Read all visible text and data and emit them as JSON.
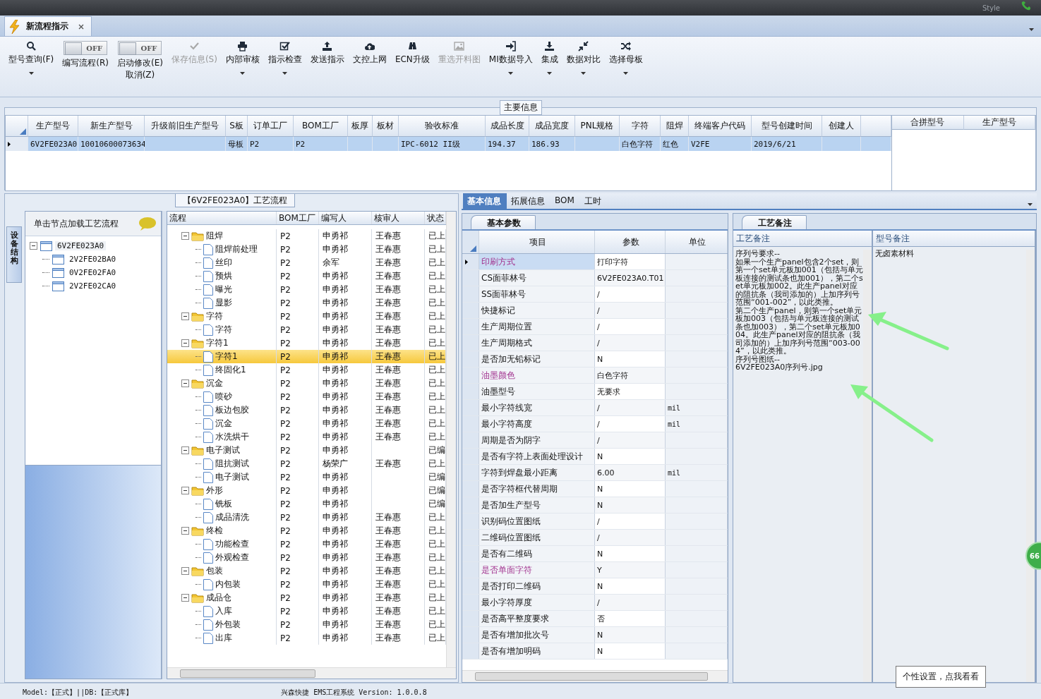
{
  "top_bar": {
    "style_label": "Style"
  },
  "document_tabs": [
    {
      "label": "新流程指示",
      "selected": true,
      "closable": true
    }
  ],
  "toolbar": [
    {
      "kind": "button",
      "label": "型号查询(F)",
      "disabled": false,
      "menu": true
    },
    {
      "kind": "toggle",
      "switch_text": "OFF",
      "on": false,
      "label": "编写流程(R)",
      "menu": false
    },
    {
      "kind": "toggle",
      "switch_text": "OFF",
      "on": false,
      "label": "启动修改(E)",
      "label_2": "取消(Z)",
      "menu": false
    },
    {
      "kind": "button",
      "label": "保存信息(S)",
      "disabled": true,
      "menu": false
    },
    {
      "kind": "button",
      "label": "内部审核",
      "disabled": false,
      "menu": true
    },
    {
      "kind": "button",
      "label": "指示检查",
      "disabled": false,
      "menu": true
    },
    {
      "kind": "button",
      "label": "发送指示",
      "disabled": false,
      "menu": false
    },
    {
      "kind": "button",
      "label": "文控上网",
      "disabled": false,
      "menu": false
    },
    {
      "kind": "button",
      "label": "ECN升级",
      "disabled": false,
      "menu": false
    },
    {
      "kind": "button",
      "label": "重选开料图",
      "disabled": true,
      "menu": false
    },
    {
      "kind": "button",
      "label": "MI数据导入",
      "disabled": false,
      "menu": true
    },
    {
      "kind": "button",
      "label": "集成",
      "disabled": false,
      "menu": true
    },
    {
      "kind": "button",
      "label": "数据对比",
      "disabled": false,
      "menu": true
    },
    {
      "kind": "button",
      "label": "选择母板",
      "disabled": false,
      "menu": true
    }
  ],
  "main_info": {
    "title": "主要信息",
    "columns": [
      "生产型号",
      "新生产型号",
      "升级前旧生产型号",
      "S板",
      "订单工厂",
      "BOM工厂",
      "板厚",
      "板材",
      "验收标准",
      "成品长度",
      "成品宽度",
      "PNL规格",
      "字符",
      "阻焊",
      "终端客户代码",
      "型号创建时间",
      "创建人"
    ],
    "rows": [
      {
        "selected": true,
        "cells": [
          "6V2FE023A0",
          "10010600073634",
          null,
          "母板",
          "P2",
          "P2",
          null,
          null,
          "IPC-6012 II级",
          "194.37",
          "186.93",
          null,
          "白色字符",
          "红色",
          "V2FE",
          "2019/6/21",
          null
        ]
      }
    ],
    "side_columns": [
      "合拼型号",
      "生产型号"
    ]
  },
  "structure_panel": {
    "side_tab": "设备结构",
    "header": "单击节点加载工艺流程",
    "tree": [
      {
        "label": "6V2FE023A0",
        "selected": true,
        "expanded": true,
        "children": [
          {
            "label": "2V2FE02BA0",
            "selected": false
          },
          {
            "label": "0V2FE02FA0",
            "selected": false
          },
          {
            "label": "2V2FE02CA0",
            "selected": false
          }
        ]
      }
    ]
  },
  "process_flow": {
    "title": "【6V2FE023A0】工艺流程",
    "columns": [
      "流程",
      "BOM工厂",
      "编写人",
      "核审人",
      "状态"
    ],
    "steps": [
      {
        "name": "阻焊",
        "factory": "P2",
        "writer": "申勇祁",
        "reviewer": "王春惠",
        "status": "已上",
        "expanded": true,
        "selected": false,
        "children": [
          {
            "name": "阻焊前处理",
            "factory": "P2",
            "writer": "申勇祁",
            "reviewer": "王春惠",
            "status": "已上",
            "selected": false
          },
          {
            "name": "丝印",
            "factory": "P2",
            "writer": "余军",
            "reviewer": "王春惠",
            "status": "已上",
            "selected": false
          },
          {
            "name": "预烘",
            "factory": "P2",
            "writer": "申勇祁",
            "reviewer": "王春惠",
            "status": "已上",
            "selected": false
          },
          {
            "name": "曝光",
            "factory": "P2",
            "writer": "申勇祁",
            "reviewer": "王春惠",
            "status": "已上",
            "selected": false
          },
          {
            "name": "显影",
            "factory": "P2",
            "writer": "申勇祁",
            "reviewer": "王春惠",
            "status": "已上",
            "selected": false
          }
        ]
      },
      {
        "name": "字符",
        "factory": "P2",
        "writer": "申勇祁",
        "reviewer": "王春惠",
        "status": "已上",
        "expanded": true,
        "selected": false,
        "children": [
          {
            "name": "字符",
            "factory": "P2",
            "writer": "申勇祁",
            "reviewer": "王春惠",
            "status": "已上",
            "selected": false
          }
        ]
      },
      {
        "name": "字符1",
        "factory": "P2",
        "writer": "申勇祁",
        "reviewer": "王春惠",
        "status": "已上",
        "expanded": true,
        "selected": false,
        "children": [
          {
            "name": "字符1",
            "factory": "P2",
            "writer": "申勇祁",
            "reviewer": "王春惠",
            "status": "已上",
            "selected": true
          },
          {
            "name": "终固化1",
            "factory": "P2",
            "writer": "申勇祁",
            "reviewer": "王春惠",
            "status": "已上",
            "selected": false
          }
        ]
      },
      {
        "name": "沉金",
        "factory": "P2",
        "writer": "申勇祁",
        "reviewer": "王春惠",
        "status": "已上",
        "expanded": true,
        "selected": false,
        "children": [
          {
            "name": "喷砂",
            "factory": "P2",
            "writer": "申勇祁",
            "reviewer": "王春惠",
            "status": "已上",
            "selected": false
          },
          {
            "name": "板边包胶",
            "factory": "P2",
            "writer": "申勇祁",
            "reviewer": "王春惠",
            "status": "已上",
            "selected": false
          },
          {
            "name": "沉金",
            "factory": "P2",
            "writer": "申勇祁",
            "reviewer": "王春惠",
            "status": "已上",
            "selected": false
          },
          {
            "name": "水洗烘干",
            "factory": "P2",
            "writer": "申勇祁",
            "reviewer": "王春惠",
            "status": "已上",
            "selected": false
          }
        ]
      },
      {
        "name": "电子测试",
        "factory": "P2",
        "writer": "申勇祁",
        "status": "已编",
        "expanded": true,
        "selected": false,
        "children": [
          {
            "name": "阻抗测试",
            "factory": "P2",
            "writer": "杨荣广",
            "reviewer": "王春惠",
            "status": "已上",
            "selected": false
          },
          {
            "name": "电子测试",
            "factory": "P2",
            "writer": "申勇祁",
            "status": "已编",
            "selected": false
          }
        ]
      },
      {
        "name": "外形",
        "factory": "P2",
        "writer": "申勇祁",
        "status": "已编",
        "expanded": true,
        "selected": false,
        "children": [
          {
            "name": "铣板",
            "factory": "P2",
            "writer": "申勇祁",
            "status": "已编",
            "selected": false
          },
          {
            "name": "成品清洗",
            "factory": "P2",
            "writer": "申勇祁",
            "reviewer": "王春惠",
            "status": "已上",
            "selected": false
          }
        ]
      },
      {
        "name": "终检",
        "factory": "P2",
        "writer": "申勇祁",
        "reviewer": "王春惠",
        "status": "已上",
        "expanded": true,
        "selected": false,
        "children": [
          {
            "name": "功能检查",
            "factory": "P2",
            "writer": "申勇祁",
            "reviewer": "王春惠",
            "status": "已上",
            "selected": false
          },
          {
            "name": "外观检查",
            "factory": "P2",
            "writer": "申勇祁",
            "reviewer": "王春惠",
            "status": "已上",
            "selected": false
          }
        ]
      },
      {
        "name": "包装",
        "factory": "P2",
        "writer": "申勇祁",
        "reviewer": "王春惠",
        "status": "已上",
        "expanded": true,
        "selected": false,
        "children": [
          {
            "name": "内包装",
            "factory": "P2",
            "writer": "申勇祁",
            "reviewer": "王春惠",
            "status": "已上",
            "selected": false
          }
        ]
      },
      {
        "name": "成品仓",
        "factory": "P2",
        "writer": "申勇祁",
        "reviewer": "王春惠",
        "status": "已上",
        "expanded": true,
        "selected": false,
        "children": [
          {
            "name": "入库",
            "factory": "P2",
            "writer": "申勇祁",
            "reviewer": "王春惠",
            "status": "已上",
            "selected": false
          },
          {
            "name": "外包装",
            "factory": "P2",
            "writer": "申勇祁",
            "reviewer": "王春惠",
            "status": "已上",
            "selected": false
          },
          {
            "name": "出库",
            "factory": "P2",
            "writer": "申勇祁",
            "reviewer": "王春惠",
            "status": "已上",
            "selected": false
          }
        ]
      }
    ]
  },
  "detail_tabs": [
    {
      "label": "基本信息",
      "selected": true
    },
    {
      "label": "拓展信息",
      "selected": false
    },
    {
      "label": "BOM",
      "selected": false
    },
    {
      "label": "工时",
      "selected": false
    }
  ],
  "parameters": {
    "tab": "基本参数",
    "columns": [
      "项目",
      "参数",
      "单位"
    ],
    "rows": [
      {
        "item": "印刷方式",
        "value": "打印字符",
        "highlighted": true,
        "selected": true
      },
      {
        "item": "CS面菲林号",
        "value": "6V2FE023A0.T01",
        "highlighted": false,
        "selected": false
      },
      {
        "item": "SS面菲林号",
        "value": "/",
        "highlighted": false,
        "selected": false
      },
      {
        "item": "快捷标记",
        "value": "/",
        "highlighted": false,
        "selected": false
      },
      {
        "item": "生产周期位置",
        "value": "/",
        "highlighted": false,
        "selected": false
      },
      {
        "item": "生产周期格式",
        "value": "/",
        "highlighted": false,
        "selected": false
      },
      {
        "item": "是否加无铅标记",
        "value": "N",
        "highlighted": false,
        "selected": false
      },
      {
        "item": "油墨颜色",
        "value": "白色字符",
        "highlighted": true,
        "selected": false
      },
      {
        "item": "油墨型号",
        "value": "无要求",
        "highlighted": false,
        "selected": false
      },
      {
        "item": "最小字符线宽",
        "value": "/",
        "unit": "mil",
        "highlighted": false,
        "selected": false
      },
      {
        "item": "最小字符高度",
        "value": "/",
        "unit": "mil",
        "highlighted": false,
        "selected": false
      },
      {
        "item": "周期是否为阴字",
        "value": "/",
        "highlighted": false,
        "selected": false
      },
      {
        "item": "是否有字符上表面处理设计",
        "value": "N",
        "highlighted": false,
        "selected": false
      },
      {
        "item": "字符到焊盘最小距离",
        "value": "6.00",
        "unit": "mil",
        "highlighted": false,
        "selected": false
      },
      {
        "item": "是否字符框代替周期",
        "value": "N",
        "highlighted": false,
        "selected": false
      },
      {
        "item": "是否加生产型号",
        "value": "N",
        "highlighted": false,
        "selected": false
      },
      {
        "item": "识别码位置图纸",
        "value": "/",
        "highlighted": false,
        "selected": false
      },
      {
        "item": "二维码位置图纸",
        "value": "/",
        "highlighted": false,
        "selected": false
      },
      {
        "item": "是否有二维码",
        "value": "N",
        "highlighted": false,
        "selected": false
      },
      {
        "item": "是否单面字符",
        "value": "Y",
        "highlighted": true,
        "selected": false
      },
      {
        "item": "是否打印二维码",
        "value": "N",
        "highlighted": false,
        "selected": false
      },
      {
        "item": "最小字符厚度",
        "value": "/",
        "highlighted": false,
        "selected": false
      },
      {
        "item": "是否高平整度要求",
        "value": "否",
        "highlighted": false,
        "selected": false
      },
      {
        "item": "是否有增加批次号",
        "value": "N",
        "highlighted": false,
        "selected": false
      },
      {
        "item": "是否有增加明码",
        "value": "N",
        "highlighted": false,
        "selected": false
      }
    ]
  },
  "remarks": {
    "tab": "工艺备注",
    "columns": [
      "工艺备注",
      "型号备注"
    ],
    "process_note": [
      "序列号要求--",
      "如果一个生产panel包含2个set，则第一个set单元板加001（包括与单元板连接的测试条也加001），第二个set单元板加002。此生产panel对应的阻抗条（我司添加的）上加序列号范围“001-002”，以此类推。",
      "第二个生产panel，则第一个set单元板加003（包括与单元板连接的测试条也加003），第二个set单元板加004。此生产panel对应的阻抗条（我司添加的）上加序列号范围“003-004”，以此类推。",
      "序列号图纸--",
      "6V2FE023A0序列号.jpg"
    ],
    "model_note": "无卤素材料"
  },
  "status_bar": {
    "mode": "Model:【正式】||DB:【正式库】",
    "product": "兴森快捷 EMS工程系统 Version: 1.0.0.8"
  },
  "tooltip": "个性设置，点我看看",
  "edge_badge": "66"
}
